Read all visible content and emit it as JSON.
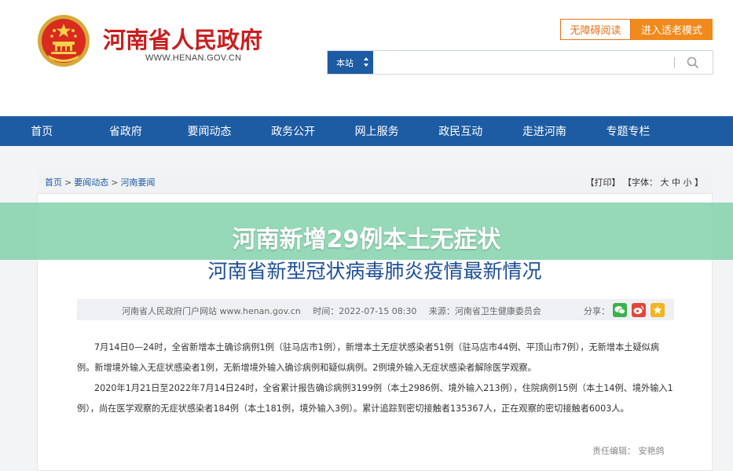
{
  "header": {
    "site_title": "河南省人民政府",
    "site_url": "WWW.HENAN.GOV.CN",
    "accessibility_btn": "无障碍阅读",
    "elder_mode_btn": "进入适老模式",
    "search": {
      "scope": "本站",
      "placeholder": ""
    }
  },
  "nav": {
    "items": [
      "首页",
      "省政府",
      "要闻动态",
      "政务公开",
      "网上服务",
      "政民互动",
      "走进河南",
      "专题专栏"
    ]
  },
  "breadcrumb": {
    "home": "首页",
    "section": "要闻动态",
    "page": "河南要闻",
    "sep": ">"
  },
  "tools": {
    "print": "【打印】",
    "font_label": "【字体：",
    "large": "大",
    "medium": "中",
    "small": "小",
    "close": "】"
  },
  "headline": "河南新增29例本土无症状",
  "article": {
    "title": "河南省新型冠状病毒肺炎疫情最新情况",
    "source_site": "河南省人民政府门户网站 www.henan.gov.cn",
    "time": "时间：2022-07-15 08:30",
    "origin": "来源：河南省卫生健康委员会",
    "share_label": "分享：",
    "paragraphs": [
      "7月14日0—24时，全省新增本土确诊病例1例（驻马店市1例），新增本土无症状感染者51例（驻马店市44例、平顶山市7例），无新增本土疑似病例。新增境外输入无症状感染者1例，无新增境外输入确诊病例和疑似病例。2例境外输入无症状感染者解除医学观察。",
      "2020年1月21日至2022年7月14日24时，全省累计报告确诊病例3199例（本土2986例、境外输入213例），住院病例15例（本土14例、境外输入1例），尚在医学观察的无症状感染者184例（本土181例，境外输入3例）。累计追踪到密切接触者135367人，正在观察的密切接触者6003人。"
    ],
    "editor": "责任编辑：  安艳鸽"
  },
  "colors": {
    "primary": "#1d5ba3",
    "brand_red": "#c81f1f",
    "orange": "#f08a1c",
    "headline_band": "#7ed1a8",
    "title_blue": "#1d4f96"
  },
  "icons": {
    "share": [
      "wechat-icon",
      "weibo-icon",
      "qzone-icon"
    ],
    "search": "search-icon",
    "emblem": "national-emblem-icon"
  }
}
